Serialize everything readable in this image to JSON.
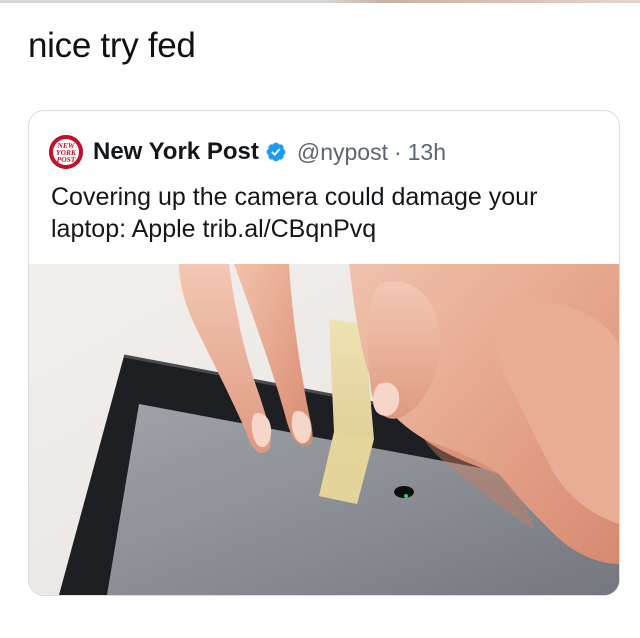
{
  "caption": "nice try fed",
  "quote": {
    "avatar_text": [
      "NEW",
      "YORK",
      "POST"
    ],
    "display_name": "New York Post",
    "verified_icon": "verified-badge-icon",
    "handle": "@nypost",
    "separator": "·",
    "time": "13h",
    "text": "Covering up the camera could damage your laptop: Apple trib.al/CBqnPvq",
    "media_alt": "photo-hands-applying-tape-to-laptop-camera"
  },
  "colors": {
    "avatar_red": "#c8102e",
    "verified_blue": "#1d9bf0",
    "secondary_text": "#5b6670",
    "border": "#d7dde1"
  }
}
